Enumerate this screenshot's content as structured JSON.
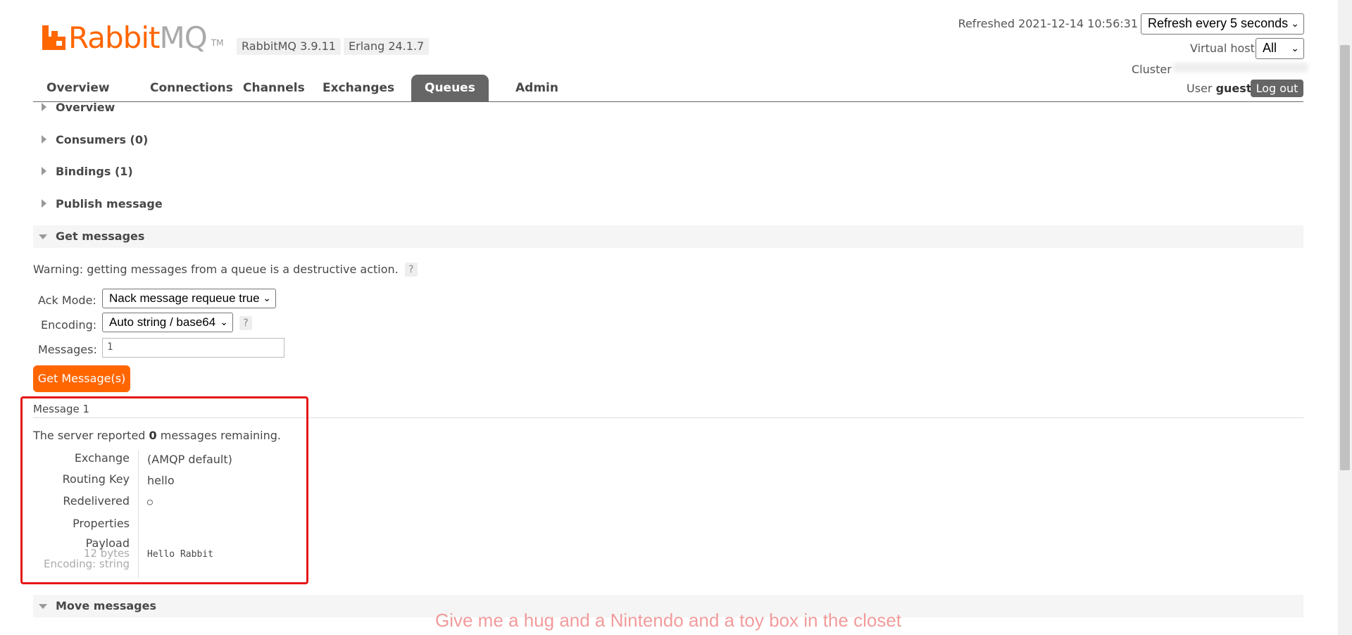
{
  "brand": {
    "name_main": "Rabbit",
    "name_accent": "MQ",
    "tm": "TM"
  },
  "versions": {
    "rabbitmq": "RabbitMQ 3.9.11",
    "erlang": "Erlang 24.1.7"
  },
  "header": {
    "refreshed": "Refreshed 2021-12-14 10:56:31",
    "refresh_select": "Refresh every 5 seconds",
    "vhost_label": "Virtual host",
    "vhost_select": "All",
    "cluster_label": "Cluster",
    "user_label": "User",
    "user_name": "guest",
    "logout": "Log out"
  },
  "tabs": [
    {
      "label": "Overview",
      "active": false
    },
    {
      "label": "Connections",
      "active": false
    },
    {
      "label": "Channels",
      "active": false
    },
    {
      "label": "Exchanges",
      "active": false
    },
    {
      "label": "Queues",
      "active": true
    },
    {
      "label": "Admin",
      "active": false
    }
  ],
  "sections": {
    "overview": "Overview",
    "consumers": "Consumers (0)",
    "bindings": "Bindings (1)",
    "publish": "Publish message",
    "get": "Get messages",
    "move": "Move messages"
  },
  "get_messages": {
    "warning": "Warning: getting messages from a queue is a destructive action.",
    "help_glyph": "?",
    "ack_label": "Ack Mode:",
    "ack_value": "Nack message requeue true",
    "encoding_label": "Encoding:",
    "encoding_value": "Auto string / base64",
    "messages_label": "Messages:",
    "messages_value": "1",
    "button": "Get Message(s)"
  },
  "message": {
    "title": "Message 1",
    "remaining_prefix": "The server reported",
    "remaining_count": "0",
    "remaining_suffix": "messages remaining.",
    "exchange_key": "Exchange",
    "exchange_val": "(AMQP default)",
    "routing_key": "Routing Key",
    "routing_val": "hello",
    "redelivered_key": "Redelivered",
    "redelivered_val": "○",
    "properties_key": "Properties",
    "payload_key": "Payload",
    "payload_bytes": "12 bytes",
    "payload_encoding": "Encoding: string",
    "payload_val": "Hello Rabbit"
  },
  "overlay": {
    "caption": "Give me a hug and a Nintendo and a toy box in the closet"
  },
  "colors": {
    "accent": "#ff6600",
    "tab_active": "#666666",
    "highlight_box": "#e31818"
  }
}
